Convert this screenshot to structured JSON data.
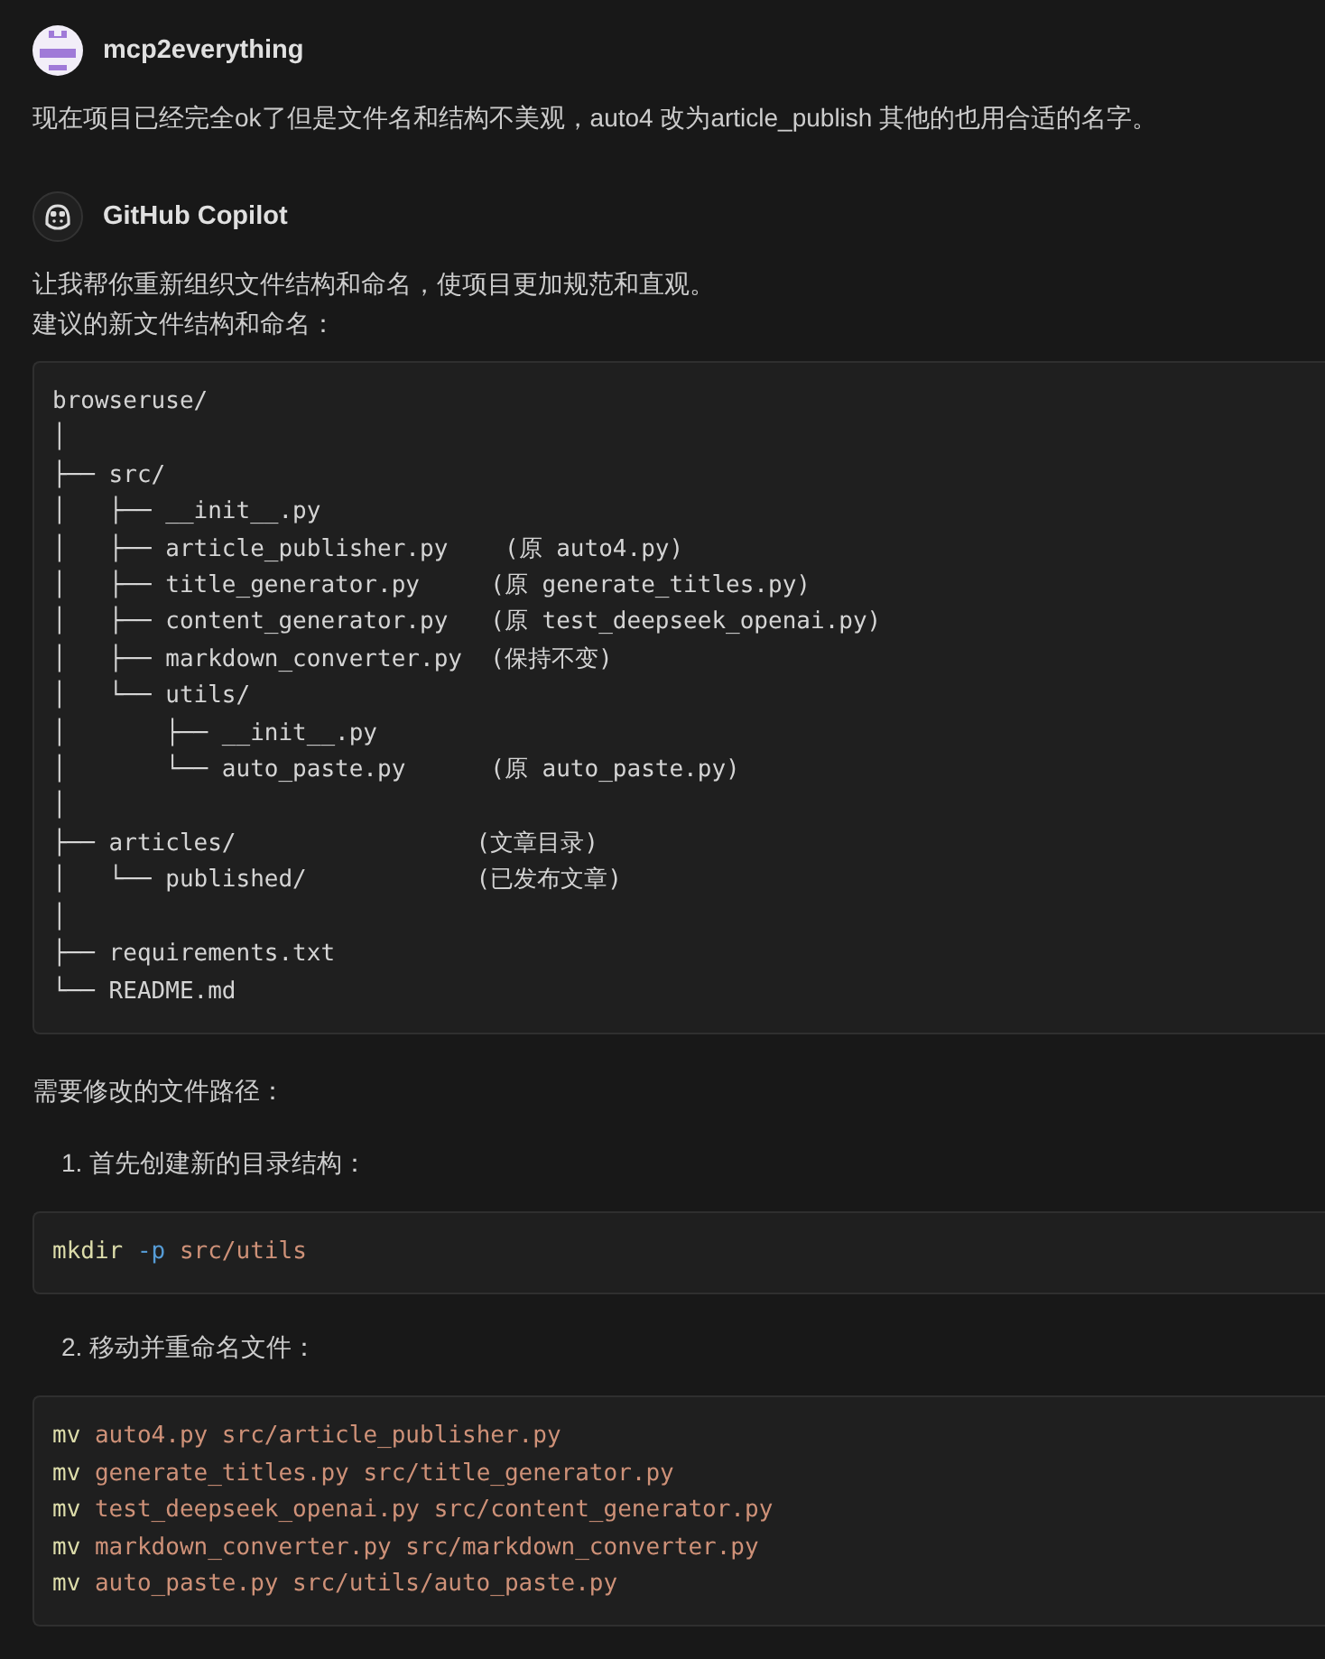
{
  "messages": [
    {
      "author": "mcp2everything",
      "kind": "user",
      "blocks": [
        {
          "kind": "paragraph",
          "text": "现在项目已经完全ok了但是文件名和结构不美观，auto4 改为article_publish 其他的也用合适的名字。"
        }
      ]
    },
    {
      "author": "GitHub Copilot",
      "kind": "copilot",
      "blocks": [
        {
          "kind": "paragraph",
          "text": "让我帮你重新组织文件结构和命名，使项目更加规范和直观。"
        },
        {
          "kind": "paragraph",
          "text": "建议的新文件结构和命名："
        },
        {
          "kind": "code",
          "lines": [
            [
              {
                "kind": "plain",
                "text": "browseruse/"
              }
            ],
            [
              {
                "kind": "plain",
                "text": "│"
              }
            ],
            [
              {
                "kind": "plain",
                "text": "├── src/"
              }
            ],
            [
              {
                "kind": "plain",
                "text": "│   ├── __init__.py"
              }
            ],
            [
              {
                "kind": "plain",
                "text": "│   ├── article_publisher.py    (原 auto4.py)"
              }
            ],
            [
              {
                "kind": "plain",
                "text": "│   ├── title_generator.py     (原 generate_titles.py)"
              }
            ],
            [
              {
                "kind": "plain",
                "text": "│   ├── content_generator.py   (原 test_deepseek_openai.py)"
              }
            ],
            [
              {
                "kind": "plain",
                "text": "│   ├── markdown_converter.py  (保持不变)"
              }
            ],
            [
              {
                "kind": "plain",
                "text": "│   └── utils/"
              }
            ],
            [
              {
                "kind": "plain",
                "text": "│       ├── __init__.py"
              }
            ],
            [
              {
                "kind": "plain",
                "text": "│       └── auto_paste.py      (原 auto_paste.py)"
              }
            ],
            [
              {
                "kind": "plain",
                "text": "│"
              }
            ],
            [
              {
                "kind": "plain",
                "text": "├── articles/                 (文章目录)"
              }
            ],
            [
              {
                "kind": "plain",
                "text": "│   └── published/            (已发布文章)"
              }
            ],
            [
              {
                "kind": "plain",
                "text": "│"
              }
            ],
            [
              {
                "kind": "plain",
                "text": "├── requirements.txt"
              }
            ],
            [
              {
                "kind": "plain",
                "text": "└── README.md"
              }
            ]
          ]
        },
        {
          "kind": "paragraph",
          "text": "需要修改的文件路径："
        },
        {
          "kind": "step",
          "number": "1.",
          "text": "首先创建新的目录结构："
        },
        {
          "kind": "code",
          "lines": [
            [
              {
                "kind": "command",
                "text": "mkdir"
              },
              {
                "kind": "flag",
                "text": "-p"
              },
              {
                "kind": "arg",
                "text": "src/utils"
              }
            ]
          ]
        },
        {
          "kind": "step",
          "number": "2.",
          "text": "移动并重命名文件："
        },
        {
          "kind": "code",
          "lines": [
            [
              {
                "kind": "command",
                "text": "mv"
              },
              {
                "kind": "arg",
                "text": "auto4.py"
              },
              {
                "kind": "arg",
                "text": "src/article_publisher.py"
              }
            ],
            [
              {
                "kind": "command",
                "text": "mv"
              },
              {
                "kind": "arg",
                "text": "generate_titles.py"
              },
              {
                "kind": "arg",
                "text": "src/title_generator.py"
              }
            ],
            [
              {
                "kind": "command",
                "text": "mv"
              },
              {
                "kind": "arg",
                "text": "test_deepseek_openai.py"
              },
              {
                "kind": "arg",
                "text": "src/content_generator.py"
              }
            ],
            [
              {
                "kind": "command",
                "text": "mv"
              },
              {
                "kind": "arg",
                "text": "markdown_converter.py"
              },
              {
                "kind": "arg",
                "text": "src/markdown_converter.py"
              }
            ],
            [
              {
                "kind": "command",
                "text": "mv"
              },
              {
                "kind": "arg",
                "text": "auto_paste.py"
              },
              {
                "kind": "arg",
                "text": "src/utils/auto_paste.py"
              }
            ]
          ]
        }
      ]
    }
  ]
}
